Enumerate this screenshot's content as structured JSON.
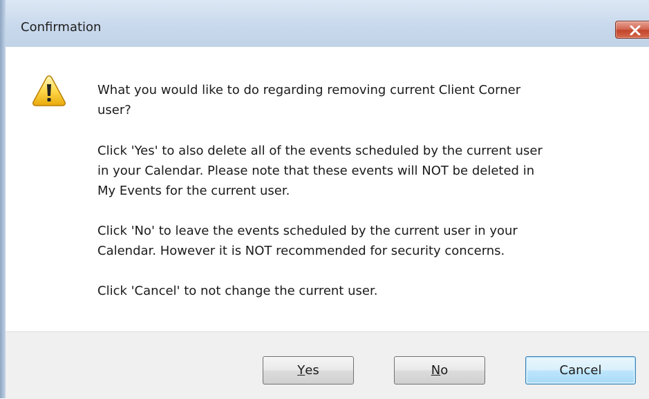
{
  "window": {
    "title": "Confirmation",
    "close_icon": "close-icon"
  },
  "message": {
    "icon": "warning-icon",
    "paragraphs": [
      "What you would like to do regarding removing current Client Corner\nuser?",
      "Click 'Yes' to also delete all of the events scheduled by the current user\nin your Calendar. Please note that these events will NOT be deleted in\nMy Events for the current user.",
      "Click 'No' to leave the events scheduled by the current user in your\nCalendar. However it is NOT recommended for security concerns.",
      "Click 'Cancel' to not change the current user."
    ]
  },
  "buttons": {
    "yes": {
      "mnemonic": "Y",
      "rest": "es"
    },
    "no": {
      "mnemonic": "N",
      "rest": "o"
    },
    "cancel": "Cancel"
  },
  "colors": {
    "titlebar": "#c9d9ec",
    "close_button": "#c2452c",
    "default_button_border": "#3c7fb1",
    "footer": "#f0f0f0"
  }
}
